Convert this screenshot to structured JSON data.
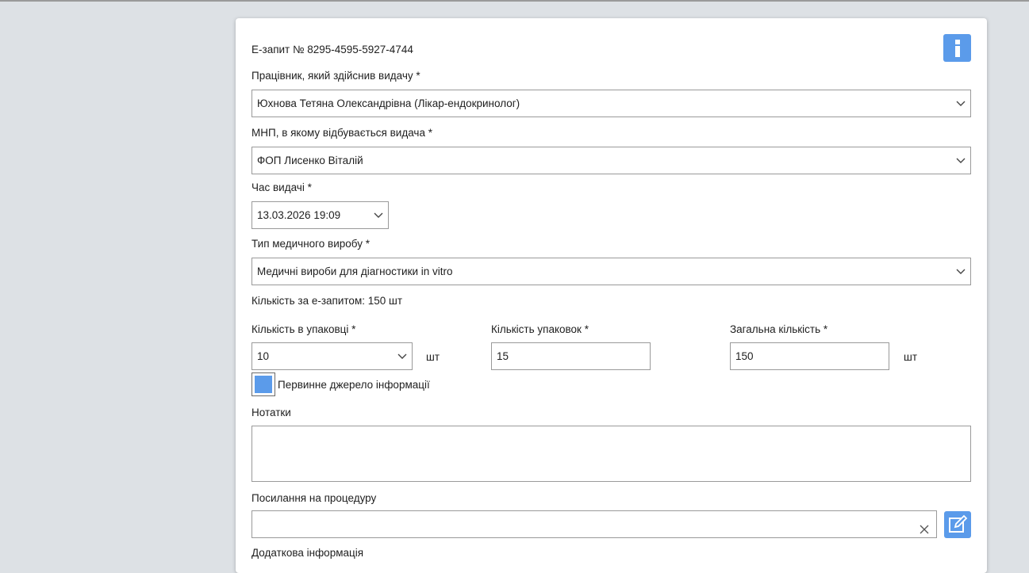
{
  "request": {
    "title": "Е-запит № 8295-4595-5927-4744"
  },
  "fields": {
    "employee": {
      "label": "Працівник, який здійснив видачу *",
      "value": "Юхнова Тетяна Олександрівна (Лікар-ендокринолог)"
    },
    "facility": {
      "label": "МНП, в якому відбувається видача *",
      "value": "ФОП Лисенко Віталій"
    },
    "issue_time": {
      "label": "Час видачі *",
      "value": "13.03.2026 19:09"
    },
    "device_type": {
      "label": "Тип медичного виробу *",
      "value": "Медичні вироби для діагностики in vitro"
    },
    "request_quantity": "Кількість за е-запитом: 150 шт",
    "pack_quantity": {
      "label": "Кількість в упаковці *",
      "value": "10",
      "unit": "шт"
    },
    "packs_count": {
      "label": "Кількість упаковок *",
      "value": "15"
    },
    "total_quantity": {
      "label": "Загальна кількість *",
      "value": "150",
      "unit": "шт"
    },
    "primary_source": {
      "label": "Первинне джерело інформації",
      "checked": true
    },
    "notes": {
      "label": "Нотатки",
      "value": ""
    },
    "procedure_link": {
      "label": "Посилання на процедуру",
      "value": ""
    },
    "additional_info": {
      "label": "Додаткова інформація"
    }
  },
  "icons": {
    "info": "info-icon",
    "chevron": "chevron-down-icon",
    "clear": "close-icon",
    "edit": "edit-icon"
  },
  "colors": {
    "accent": "#5b9bea",
    "background": "#dde1e5",
    "card": "#ffffff",
    "border": "#9a9a9a"
  }
}
